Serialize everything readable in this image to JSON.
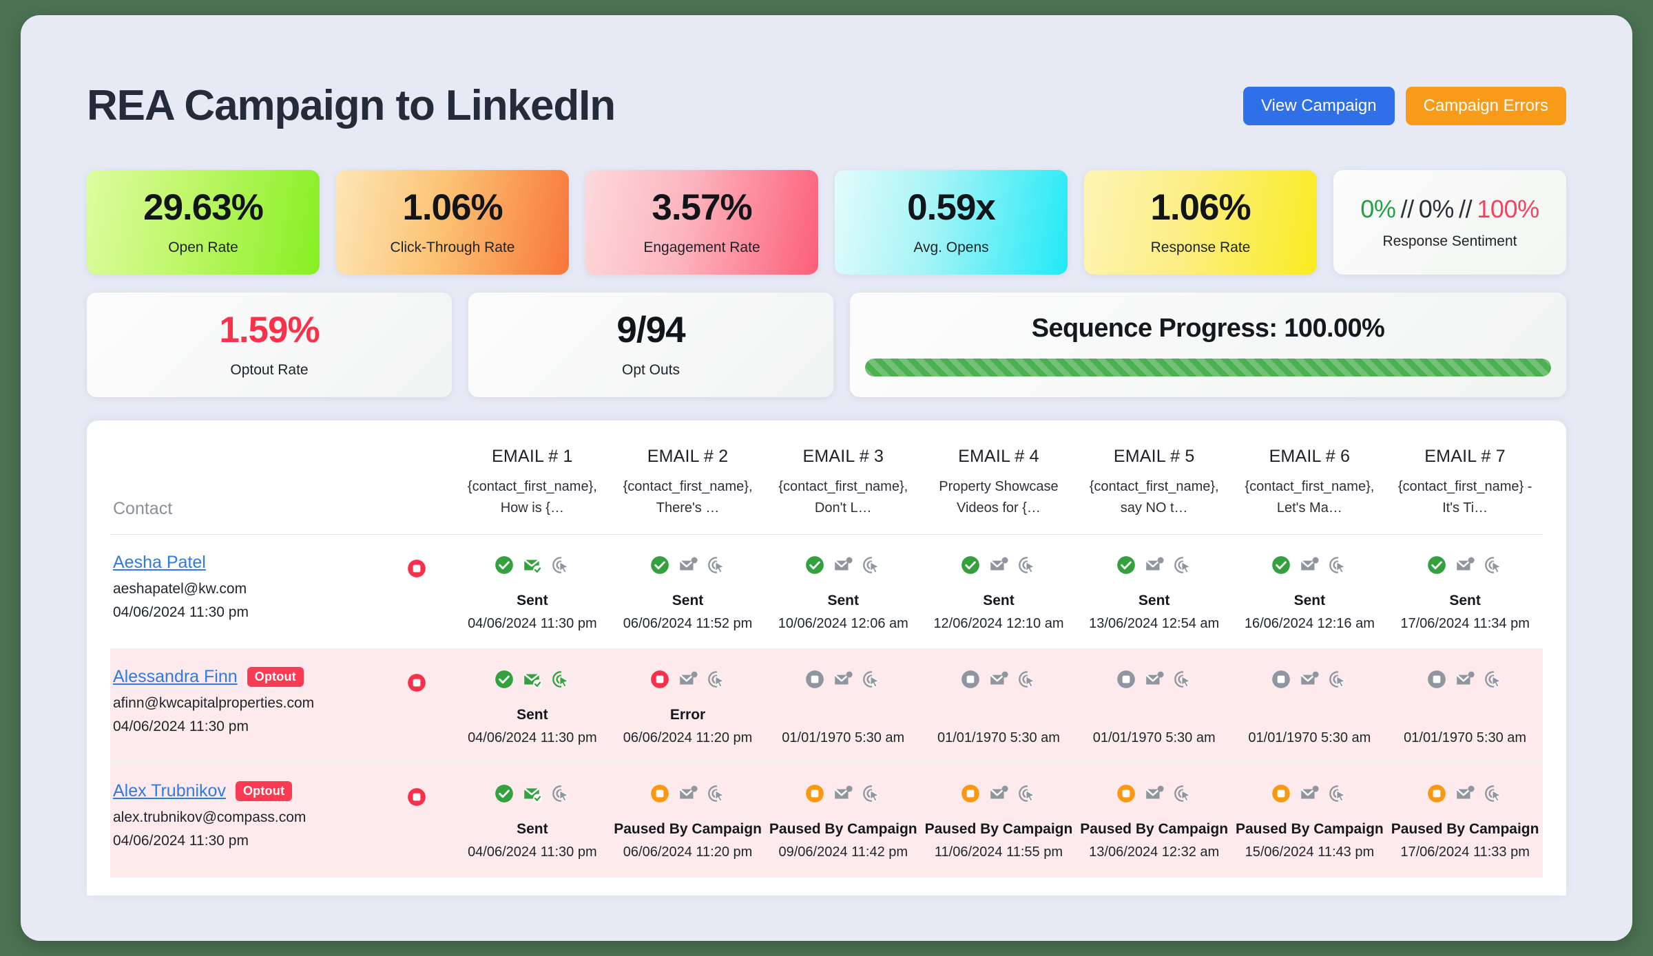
{
  "header": {
    "title": "REA Campaign to LinkedIn",
    "buttons": [
      {
        "label": "View Campaign",
        "color": "#2f6fe8"
      },
      {
        "label": "Campaign Errors",
        "color": "#f89b19"
      }
    ]
  },
  "metrics_row1": [
    {
      "value": "29.63%",
      "label": "Open Rate",
      "style": "m-green"
    },
    {
      "value": "1.06%",
      "label": "Click-Through Rate",
      "style": "m-orange"
    },
    {
      "value": "3.57%",
      "label": "Engagement Rate",
      "style": "m-pink"
    },
    {
      "value": "0.59x",
      "label": "Avg. Opens",
      "style": "m-cyan"
    },
    {
      "value": "1.06%",
      "label": "Response Rate",
      "style": "m-yellow"
    }
  ],
  "sentiment": {
    "positive": "0%",
    "neutral": "0%",
    "negative": "100%",
    "separator": "//",
    "label": "Response Sentiment",
    "positive_color": "#22a33f",
    "neutral_color": "#2b3038",
    "negative_color": "#fb3f5c"
  },
  "metrics_row2": [
    {
      "value": "1.59%",
      "label": "Optout Rate",
      "value_color": "#fb3149"
    },
    {
      "value": "9/94",
      "label": "Opt Outs",
      "value_color": "#111418"
    }
  ],
  "progress": {
    "title": "Sequence Progress: 100.00%",
    "percent": 100,
    "fill_color": "#4caf50"
  },
  "table": {
    "contact_header": "Contact",
    "columns": [
      {
        "num": "EMAIL # 1",
        "subject_line1": "{contact_first_name},",
        "subject_line2": "How is {…"
      },
      {
        "num": "EMAIL # 2",
        "subject_line1": "{contact_first_name},",
        "subject_line2": "There's …"
      },
      {
        "num": "EMAIL # 3",
        "subject_line1": "{contact_first_name},",
        "subject_line2": "Don't L…"
      },
      {
        "num": "EMAIL # 4",
        "subject_line1": "Property Showcase",
        "subject_line2": "Videos for {…"
      },
      {
        "num": "EMAIL # 5",
        "subject_line1": "{contact_first_name},",
        "subject_line2": "say NO t…"
      },
      {
        "num": "EMAIL # 6",
        "subject_line1": "{contact_first_name},",
        "subject_line2": "Let's Ma…"
      },
      {
        "num": "EMAIL # 7",
        "subject_line1": "{contact_first_name} -",
        "subject_line2": "It's Ti…"
      }
    ],
    "rows": [
      {
        "name": "Aesha Patel",
        "badge": "",
        "email": "aeshapatel@kw.com",
        "date": "04/06/2024 11:30 pm",
        "optout": false,
        "stop_icon": "red",
        "cells": [
          {
            "status": "Sent",
            "date": "04/06/2024 11:30 pm",
            "stop": "green",
            "mail": "green",
            "click": "gray"
          },
          {
            "status": "Sent",
            "date": "06/06/2024 11:52 pm",
            "stop": "green",
            "mail": "gray",
            "click": "gray"
          },
          {
            "status": "Sent",
            "date": "10/06/2024 12:06 am",
            "stop": "green",
            "mail": "gray",
            "click": "gray"
          },
          {
            "status": "Sent",
            "date": "12/06/2024 12:10 am",
            "stop": "green",
            "mail": "gray",
            "click": "gray"
          },
          {
            "status": "Sent",
            "date": "13/06/2024 12:54 am",
            "stop": "green",
            "mail": "gray",
            "click": "gray"
          },
          {
            "status": "Sent",
            "date": "16/06/2024 12:16 am",
            "stop": "green",
            "mail": "gray",
            "click": "gray"
          },
          {
            "status": "Sent",
            "date": "17/06/2024 11:34 pm",
            "stop": "green",
            "mail": "gray",
            "click": "gray"
          }
        ]
      },
      {
        "name": "Alessandra Finn",
        "badge": "Optout",
        "email": "afinn@kwcapitalproperties.com",
        "date": "04/06/2024 11:30 pm",
        "optout": true,
        "stop_icon": "red",
        "cells": [
          {
            "status": "Sent",
            "date": "04/06/2024 11:30 pm",
            "stop": "green",
            "mail": "green",
            "click": "green"
          },
          {
            "status": "Error",
            "date": "06/06/2024 11:20 pm",
            "stop": "red",
            "mail": "gray",
            "click": "gray"
          },
          {
            "status": "",
            "date": "01/01/1970 5:30 am",
            "stop": "gray",
            "mail": "gray",
            "click": "gray"
          },
          {
            "status": "",
            "date": "01/01/1970 5:30 am",
            "stop": "gray",
            "mail": "gray",
            "click": "gray"
          },
          {
            "status": "",
            "date": "01/01/1970 5:30 am",
            "stop": "gray",
            "mail": "gray",
            "click": "gray"
          },
          {
            "status": "",
            "date": "01/01/1970 5:30 am",
            "stop": "gray",
            "mail": "gray",
            "click": "gray"
          },
          {
            "status": "",
            "date": "01/01/1970 5:30 am",
            "stop": "gray",
            "mail": "gray",
            "click": "gray"
          }
        ]
      },
      {
        "name": "Alex Trubnikov",
        "badge": "Optout",
        "email": "alex.trubnikov@compass.com",
        "date": "04/06/2024 11:30 pm",
        "optout": true,
        "stop_icon": "red",
        "cells": [
          {
            "status": "Sent",
            "date": "04/06/2024 11:30 pm",
            "stop": "green",
            "mail": "green",
            "click": "gray"
          },
          {
            "status": "Paused By Campaign",
            "date": "06/06/2024 11:20 pm",
            "stop": "orange",
            "mail": "gray",
            "click": "gray"
          },
          {
            "status": "Paused By Campaign",
            "date": "09/06/2024 11:42 pm",
            "stop": "orange",
            "mail": "gray",
            "click": "gray"
          },
          {
            "status": "Paused By Campaign",
            "date": "11/06/2024 11:55 pm",
            "stop": "orange",
            "mail": "gray",
            "click": "gray"
          },
          {
            "status": "Paused By Campaign",
            "date": "13/06/2024 12:32 am",
            "stop": "orange",
            "mail": "gray",
            "click": "gray"
          },
          {
            "status": "Paused By Campaign",
            "date": "15/06/2024 11:43 pm",
            "stop": "orange",
            "mail": "gray",
            "click": "gray"
          },
          {
            "status": "Paused By Campaign",
            "date": "17/06/2024 11:33 pm",
            "stop": "orange",
            "mail": "gray",
            "click": "gray"
          }
        ]
      }
    ]
  },
  "icon_colors": {
    "red": "#f8304b",
    "green": "#34a13f",
    "orange": "#f99812",
    "gray": "#8f969f"
  }
}
